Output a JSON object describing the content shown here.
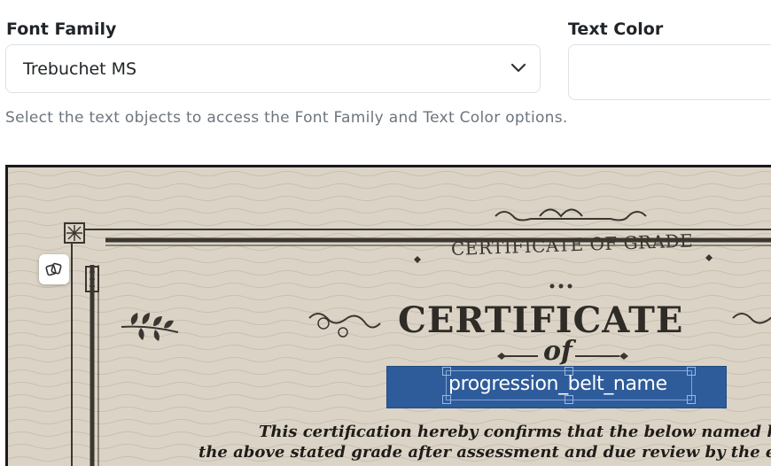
{
  "font_family": {
    "label": "Font Family",
    "selected": "Trebuchet MS"
  },
  "text_color": {
    "label": "Text Color",
    "value": ""
  },
  "hint": "Select the text objects to access the Font Family and Text Color options.",
  "certificate": {
    "subtitle": "CERTIFICATE OF GRADE",
    "heading": "CERTIFICATE",
    "of": "of",
    "field_label": "progression_belt_name",
    "body_line_1": "This certification hereby confirms that the below named has",
    "body_line_2": "the above stated grade after assessment and due review by the exam"
  },
  "icons": {
    "chevron": "chevron-down-icon",
    "float_button": "duplicate-icon"
  },
  "colors": {
    "field_background": "#2e5b9a",
    "paper": "#d9d2c4"
  }
}
